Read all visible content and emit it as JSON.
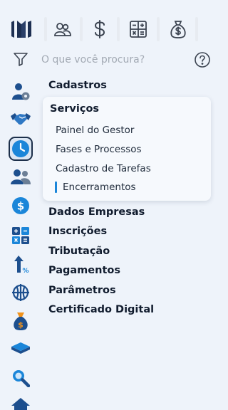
{
  "search": {
    "placeholder": "O que você procura?"
  },
  "top_tabs": [
    {
      "icon": "people-icon"
    },
    {
      "icon": "dollar-icon"
    },
    {
      "icon": "calculator-icon"
    },
    {
      "icon": "money-bag-icon"
    }
  ],
  "sidebar": {
    "items": [
      {
        "icon": "user-settings-icon"
      },
      {
        "icon": "handshake-icon"
      },
      {
        "icon": "clock-icon",
        "active": true
      },
      {
        "icon": "users-icon"
      },
      {
        "icon": "dollar-circle-icon"
      },
      {
        "icon": "calculator-icon"
      },
      {
        "icon": "tax-arrow-icon"
      },
      {
        "icon": "network-icon"
      },
      {
        "icon": "money-bag-icon"
      },
      {
        "icon": "layers-icon"
      },
      {
        "icon": "magnifier-icon"
      },
      {
        "icon": "home-icon"
      }
    ]
  },
  "menu": {
    "cadastros": "Cadastros",
    "servicos": {
      "title": "Serviços",
      "items": [
        "Painel do Gestor",
        "Fases e Processos",
        "Cadastro de Tarefas",
        "Encerramentos"
      ],
      "active_index": 3
    },
    "dados_empresas": "Dados Empresas",
    "inscricoes": "Inscrições",
    "tributacao": "Tributação",
    "pagamentos": "Pagamentos",
    "parametros": "Parâmetros",
    "certificado": "Certificado Digital"
  },
  "colors": {
    "background": "#eef3fa",
    "brand": "#1d2f52",
    "accent_blue": "#1b86d9",
    "orange": "#f2931c"
  }
}
